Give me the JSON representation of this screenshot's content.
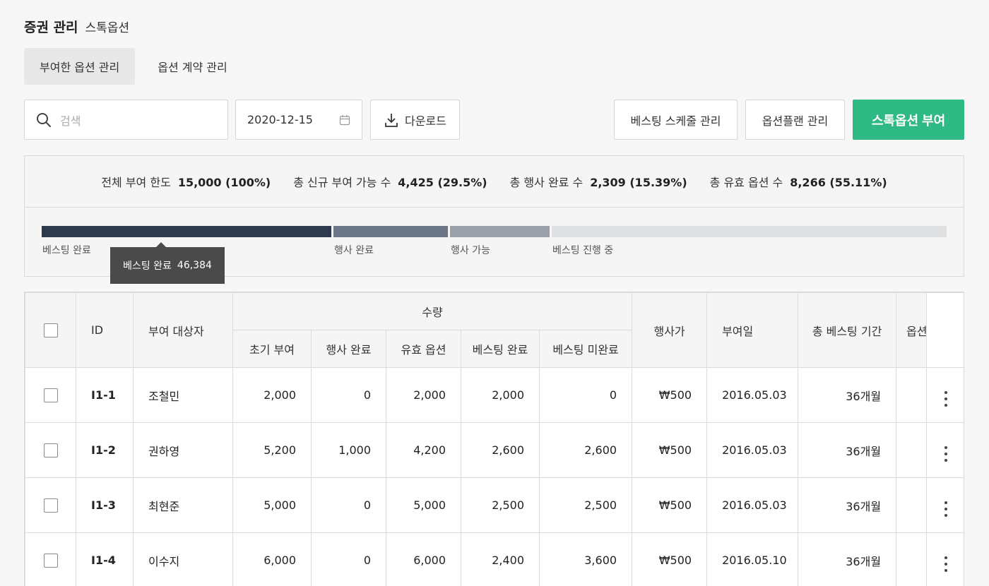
{
  "header": {
    "title": "증권 관리",
    "subtitle": "스톡옵션"
  },
  "tabs": [
    {
      "label": "부여한 옵션 관리",
      "active": true
    },
    {
      "label": "옵션 계약 관리",
      "active": false
    }
  ],
  "toolbar": {
    "search_placeholder": "검색",
    "date_value": "2020-12-15",
    "download_label": "다운로드",
    "vesting_schedule_label": "베스팅 스케줄 관리",
    "option_plan_label": "옵션플랜 관리",
    "grant_label": "스톡옵션 부여"
  },
  "summary": {
    "stats": [
      {
        "label": "전체 부여 한도",
        "value": "15,000 (100%)"
      },
      {
        "label": "총 신규 부여 가능 수",
        "value": "4,425 (29.5%)"
      },
      {
        "label": "총 행사 완료 수",
        "value": "2,309 (15.39%)"
      },
      {
        "label": "총 유효 옵션 수",
        "value": "8,266 (55.11%)"
      }
    ],
    "segments": [
      {
        "label": "베스팅 완료",
        "color": "#2c3a4c",
        "share": 0.322
      },
      {
        "label": "행사 완료",
        "color": "#6b7687",
        "share": 0.127
      },
      {
        "label": "행사 가능",
        "color": "#9aa0a8",
        "share": 0.111
      },
      {
        "label": "베스팅 진행 중",
        "color": "#dfe0e2",
        "share": 0.44
      }
    ],
    "tooltip": {
      "label": "베스팅 완료",
      "value": "46,384"
    }
  },
  "table": {
    "headers": {
      "id": "ID",
      "grantee": "부여 대상자",
      "quantity_group": "수량",
      "initial_grant": "초기 부여",
      "exercised": "행사 완료",
      "valid_options": "유효 옵션",
      "vested": "베스팅 완료",
      "unvested": "베스팅 미완료",
      "exercise_price": "행사가",
      "grant_date": "부여일",
      "total_vesting_period": "총 베스팅 기간",
      "option_truncated": "옵션"
    },
    "rows": [
      {
        "id": "I1-1",
        "grantee": "조철민",
        "initial": "2,000",
        "exercised": "0",
        "valid": "2,000",
        "vested": "2,000",
        "unvested": "0",
        "price": "₩500",
        "date": "2016.05.03",
        "period": "36개월"
      },
      {
        "id": "I1-2",
        "grantee": "권하영",
        "initial": "5,200",
        "exercised": "1,000",
        "valid": "4,200",
        "vested": "2,600",
        "unvested": "2,600",
        "price": "₩500",
        "date": "2016.05.03",
        "period": "36개월"
      },
      {
        "id": "I1-3",
        "grantee": "최현준",
        "initial": "5,000",
        "exercised": "0",
        "valid": "5,000",
        "vested": "2,500",
        "unvested": "2,500",
        "price": "₩500",
        "date": "2016.05.03",
        "period": "36개월"
      },
      {
        "id": "I1-4",
        "grantee": "이수지",
        "initial": "6,000",
        "exercised": "0",
        "valid": "6,000",
        "vested": "2,400",
        "unvested": "3,600",
        "price": "₩500",
        "date": "2016.05.10",
        "period": "36개월"
      }
    ]
  },
  "colors": {
    "accent": "#2fb984"
  }
}
